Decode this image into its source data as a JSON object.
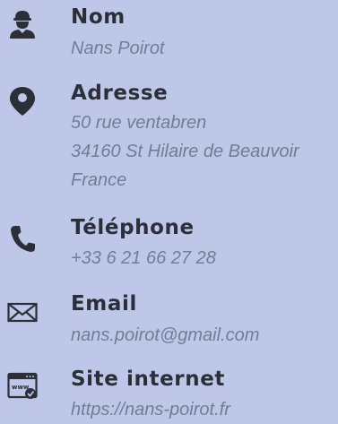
{
  "contact": {
    "name": {
      "icon": "person-icon",
      "label": "Nom",
      "value": "Nans Poirot"
    },
    "address": {
      "icon": "location-pin-icon",
      "label": "Adresse",
      "lines": [
        "50 rue ventabren",
        "34160 St Hilaire de Beauvoir",
        "France"
      ]
    },
    "phone": {
      "icon": "phone-icon",
      "label": "Téléphone",
      "value": "+33 6 21 66 27 28"
    },
    "email": {
      "icon": "envelope-icon",
      "label": "Email",
      "value": "nans.poirot@gmail.com"
    },
    "website": {
      "icon": "browser-window-icon",
      "label": "Site internet",
      "value": "https://nans-poirot.fr"
    }
  },
  "colors": {
    "background": "#bfc7e8",
    "label": "#2b2f38",
    "value": "#737c94",
    "icon": "#2b2f38"
  }
}
